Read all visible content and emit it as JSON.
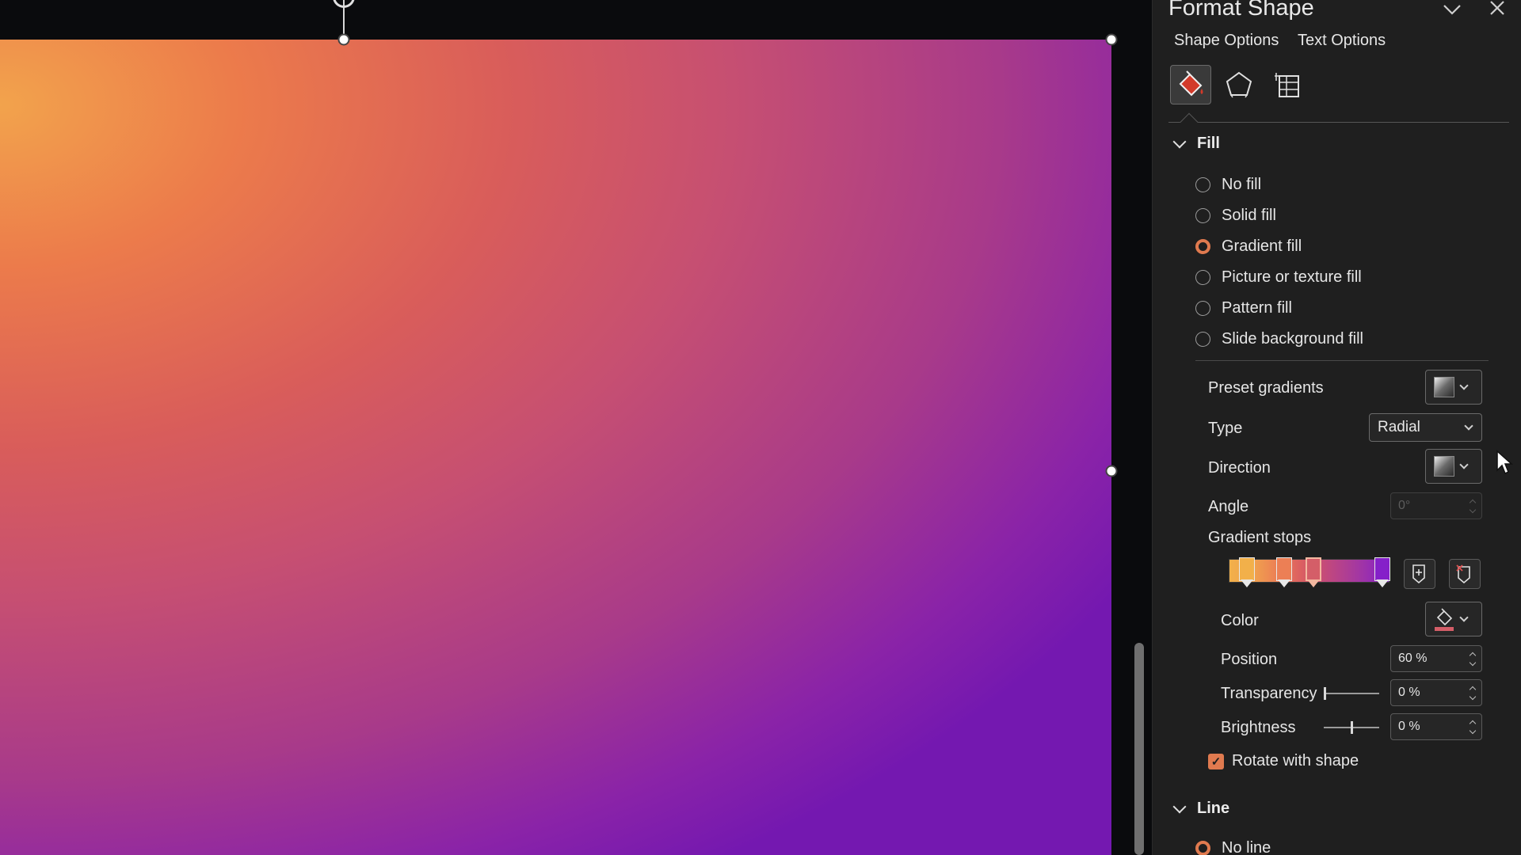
{
  "pane": {
    "title": "Format Shape",
    "tabs": {
      "shape_options": "Shape Options",
      "text_options": "Text Options"
    }
  },
  "fill": {
    "header": "Fill",
    "options": [
      {
        "label": "No fill",
        "checked": false
      },
      {
        "label": "Solid fill",
        "checked": false
      },
      {
        "label": "Gradient fill",
        "checked": true
      },
      {
        "label": "Picture or texture fill",
        "checked": false
      },
      {
        "label": "Pattern fill",
        "checked": false
      },
      {
        "label": "Slide background fill",
        "checked": false
      }
    ],
    "preset_gradients_label": "Preset gradients",
    "type_label": "Type",
    "type_value": "Radial",
    "direction_label": "Direction",
    "angle_label": "Angle",
    "angle_value": "0°",
    "gradient_stops_label": "Gradient stops",
    "stops": [
      {
        "color": "#f2b04a",
        "selected": false
      },
      {
        "color": "#ec7f55",
        "selected": false
      },
      {
        "color": "#d45e68",
        "selected": true
      },
      {
        "color": "#8520c9",
        "selected": false
      }
    ],
    "color_label": "Color",
    "position_label": "Position",
    "position_value": "60 %",
    "transparency_label": "Transparency",
    "transparency_value": "0 %",
    "brightness_label": "Brightness",
    "brightness_value": "0 %",
    "rotate_label": "Rotate with shape",
    "rotate_checked": true
  },
  "line": {
    "header": "Line",
    "first_option": "No line"
  },
  "colors": {
    "accent": "#e07a4f",
    "pane_bg": "#1f1f1f",
    "selected_stop_color": "#d45e68"
  }
}
